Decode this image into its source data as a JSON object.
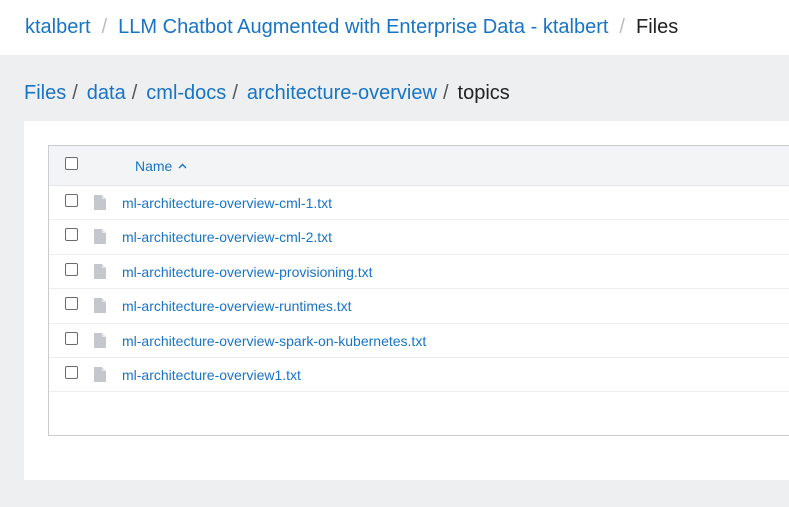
{
  "header": {
    "breadcrumb": [
      {
        "label": "ktalbert",
        "link": true
      },
      {
        "label": "LLM Chatbot Augmented with Enterprise Data - ktalbert",
        "link": true
      },
      {
        "label": "Files",
        "link": false
      }
    ]
  },
  "path": {
    "segments": [
      {
        "label": "Files",
        "link": true
      },
      {
        "label": "data",
        "link": true
      },
      {
        "label": "cml-docs",
        "link": true
      },
      {
        "label": "architecture-overview",
        "link": true
      },
      {
        "label": "topics",
        "link": false
      }
    ]
  },
  "table": {
    "name_header": "Name",
    "sort": "ascending",
    "files": [
      "ml-architecture-overview-cml-1.txt",
      "ml-architecture-overview-cml-2.txt",
      "ml-architecture-overview-provisioning.txt",
      "ml-architecture-overview-runtimes.txt",
      "ml-architecture-overview-spark-on-kubernetes.txt",
      "ml-architecture-overview1.txt"
    ]
  },
  "colors": {
    "link": "#1874c4",
    "background": "#eeeff1"
  }
}
